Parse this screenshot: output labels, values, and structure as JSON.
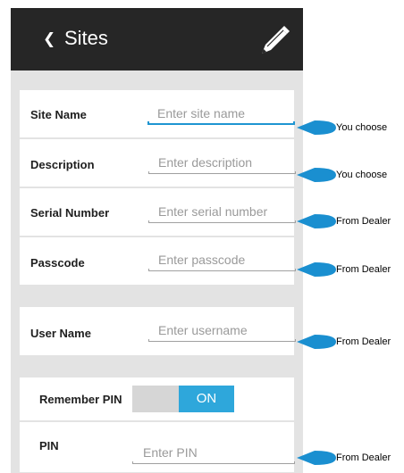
{
  "header": {
    "back_icon": "chevron-left-icon",
    "title": "Sites",
    "edit_icon": "pencil-icon"
  },
  "site_group": {
    "site_name": {
      "label": "Site Name",
      "placeholder": "Enter site name"
    },
    "description": {
      "label": "Description",
      "placeholder": "Enter description"
    },
    "serial_number": {
      "label": "Serial Number",
      "placeholder": "Enter serial number"
    },
    "passcode": {
      "label": "Passcode",
      "placeholder": "Enter passcode"
    }
  },
  "user_group": {
    "user_name": {
      "label": "User Name",
      "placeholder": "Enter username"
    }
  },
  "pin_group": {
    "remember_pin": {
      "label": "Remember PIN",
      "state": "ON"
    },
    "pin": {
      "label": "PIN",
      "placeholder": "Enter PIN"
    }
  },
  "callouts": [
    "You choose",
    "You choose",
    "From Dealer",
    "From Dealer",
    "From Dealer",
    "From Dealer"
  ],
  "colors": {
    "accent": "#2ea7db",
    "topbar": "#262626",
    "callout": "#1a8fd0"
  }
}
